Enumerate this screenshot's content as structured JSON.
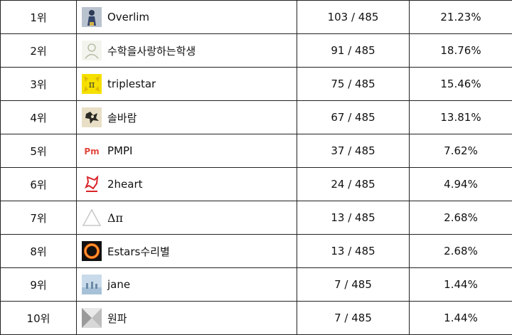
{
  "ranking": {
    "rows": [
      {
        "rank": "1위",
        "name": "Overlim",
        "score": "103 / 485",
        "percent": "21.23%",
        "avatar": "person-figure-icon"
      },
      {
        "rank": "2위",
        "name": "수학을사랑하는학생",
        "score": "91 / 485",
        "percent": "18.76%",
        "avatar": "default-user-icon"
      },
      {
        "rank": "3위",
        "name": "triplestar",
        "score": "75 / 485",
        "percent": "15.46%",
        "avatar": "pi-badge-icon"
      },
      {
        "rank": "4위",
        "name": "솔바람",
        "score": "67 / 485",
        "percent": "13.81%",
        "avatar": "character-icon"
      },
      {
        "rank": "5위",
        "name": "PMPI",
        "score": "37 / 485",
        "percent": "7.62%",
        "avatar": "pm-logo-icon"
      },
      {
        "rank": "6위",
        "name": "2heart",
        "score": "24 / 485",
        "percent": "4.94%",
        "avatar": "griffin-logo-icon"
      },
      {
        "rank": "7위",
        "name": "Δπ",
        "score": "13 / 485",
        "percent": "2.68%",
        "avatar": "triangle-outline-icon"
      },
      {
        "rank": "8위",
        "name": "Estars수리별",
        "score": "13 / 485",
        "percent": "2.68%",
        "avatar": "fire-ring-icon"
      },
      {
        "rank": "9위",
        "name": "jane",
        "score": "7 / 485",
        "percent": "1.44%",
        "avatar": "landscape-photo-icon"
      },
      {
        "rank": "10위",
        "name": "원파",
        "score": "7 / 485",
        "percent": "1.44%",
        "avatar": "gray-geometric-icon"
      }
    ]
  }
}
